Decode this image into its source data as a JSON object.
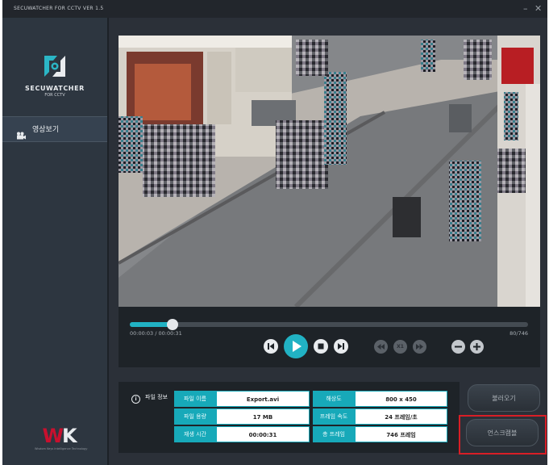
{
  "window": {
    "title": "SECUWATCHER FOR CCTV VER 1.5",
    "minimize": "–",
    "close": "✕"
  },
  "brand": {
    "name": "SECUWATCHER",
    "sub": "FOR CCTV"
  },
  "sidebar": {
    "items": [
      {
        "label": "영상보기",
        "icon": "video-camera-icon"
      }
    ]
  },
  "footer_logo": {
    "text": "WK",
    "sub": "Wisdom Keys Intelligence Technology"
  },
  "player": {
    "time": "00:00:03 / 00:00:31",
    "frames": "80/746",
    "progress": 0.107,
    "speed_label": "X1"
  },
  "file_info": {
    "title": "파일 정보",
    "rows_left": [
      {
        "key": "파일 이름",
        "value": "Export.avi"
      },
      {
        "key": "파일 용량",
        "value": "17 MB"
      },
      {
        "key": "재생 시간",
        "value": "00:00:31"
      }
    ],
    "rows_right": [
      {
        "key": "해상도",
        "value": "800 x 450"
      },
      {
        "key": "프레임 속도",
        "value": "24 프레임/초"
      },
      {
        "key": "총 프레임",
        "value": "746 프레임"
      }
    ]
  },
  "buttons": {
    "load": "불러오기",
    "unscramble": "언스크램블"
  },
  "colors": {
    "accent": "#17a9b9",
    "highlight": "#d81e26",
    "wk_red": "#c8102e"
  }
}
